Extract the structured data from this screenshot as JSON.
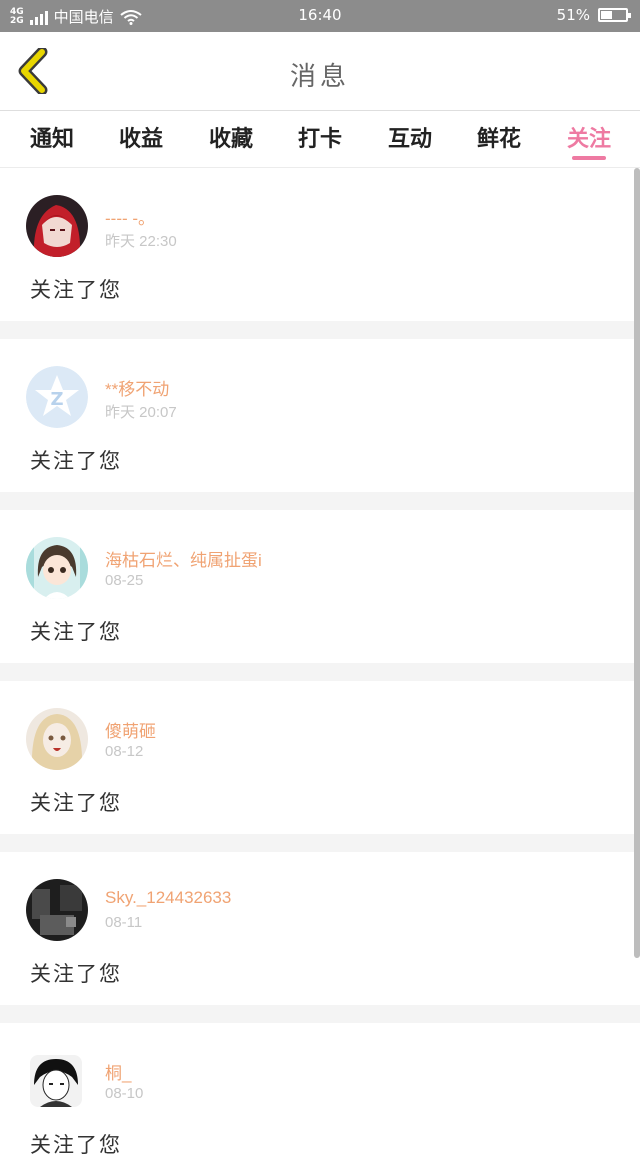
{
  "status_bar": {
    "network_top": "4G",
    "network_bottom": "2G",
    "carrier": "中国电信",
    "time": "16:40",
    "battery_text": "51%",
    "battery_level": 0.51
  },
  "header": {
    "back_icon": "chevron-left-icon",
    "title": "消息"
  },
  "tabs": [
    {
      "label": "通知"
    },
    {
      "label": "收益"
    },
    {
      "label": "收藏"
    },
    {
      "label": "打卡"
    },
    {
      "label": "互动"
    },
    {
      "label": "鲜花"
    },
    {
      "label": "关注"
    }
  ],
  "active_tab": "关注",
  "colors": {
    "accent": "#ee7aa2",
    "username": "#f0a373",
    "back_arrow": "#e8d600"
  },
  "messages": [
    {
      "username": "---- -。",
      "time": "昨天 22:30",
      "text": "关注了您",
      "avatar": "red-hair-avatar"
    },
    {
      "username": "**移不动",
      "time": "昨天 20:07",
      "text": "关注了您",
      "avatar": "qzone-default-avatar"
    },
    {
      "username": "海枯石烂、纯属扯蛋i",
      "time": "08-25",
      "text": "关注了您",
      "avatar": "cartoon-girl-avatar"
    },
    {
      "username": "傻萌砸",
      "time": "08-12",
      "text": "关注了您",
      "avatar": "blonde-doll-avatar"
    },
    {
      "username": "Sky._124432633",
      "time": "08-11",
      "text": "关注了您",
      "avatar": "dark-photo-avatar"
    },
    {
      "username": "桐_",
      "time": "08-10",
      "text": "关注了您",
      "avatar": "anime-boy-avatar"
    }
  ]
}
